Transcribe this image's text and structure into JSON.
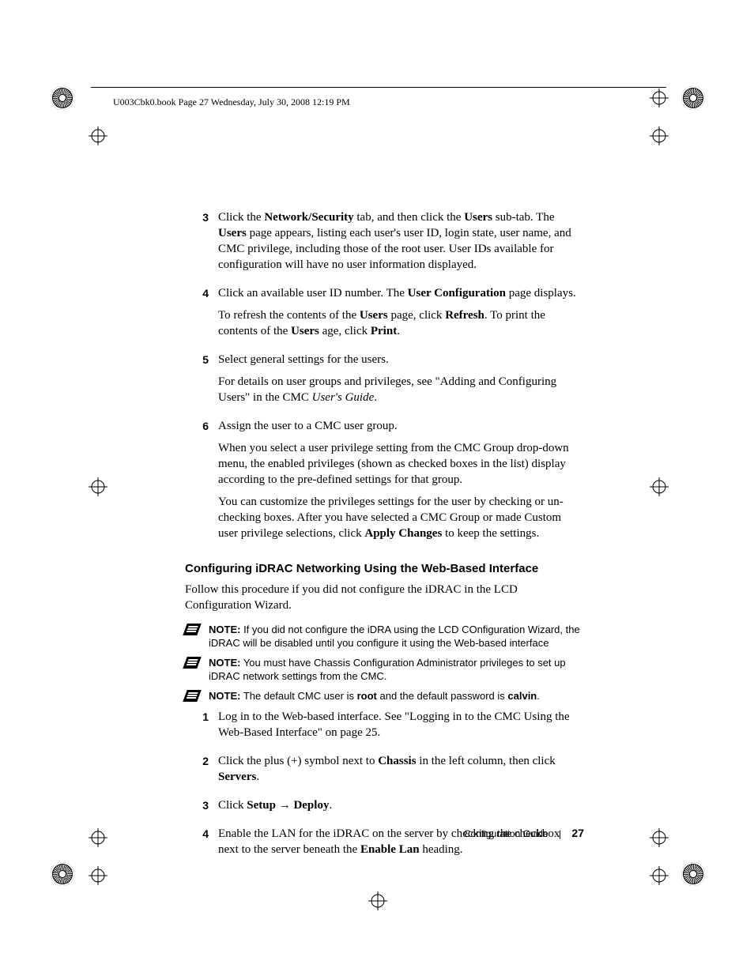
{
  "header": "U003Cbk0.book  Page 27  Wednesday, July 30, 2008  12:19 PM",
  "steps_a": [
    {
      "n": "3",
      "paras": [
        "Click the <b>Network/Security</b> tab, and then click the <b>Users</b> sub-tab. The <b>Users</b> page appears, listing each user's user ID, login state, user name, and CMC privilege, including those of the root user. User IDs available for configuration will have no user information displayed."
      ]
    },
    {
      "n": "4",
      "paras": [
        "Click an available user ID number. The <b>User Configuration</b> page displays.",
        "To refresh the contents of the <b>Users</b> page, click <b>Refresh</b>. To print the contents of the <b>Users</b> age, click <b>Print</b>."
      ]
    },
    {
      "n": "5",
      "paras": [
        "Select general settings for the users.",
        "For details on user groups and privileges, see \"Adding and Configuring Users\" in the CMC <i>User's Guide</i>."
      ]
    },
    {
      "n": "6",
      "paras": [
        "Assign the user to a CMC user group.",
        "When you select a user privilege setting from the CMC Group drop-down menu, the enabled privileges (shown as checked boxes in the list) display according to the pre-defined settings for that group.",
        "You can customize the privileges settings for the user by checking or un-checking boxes. After you have selected a CMC Group or made Custom user privilege selections, click <b>Apply Changes</b> to keep the settings."
      ]
    }
  ],
  "heading": "Configuring iDRAC Networking Using the Web-Based Interface",
  "intro": "Follow this procedure if you did not configure the iDRAC in the LCD Configuration Wizard.",
  "notes": [
    "<b>NOTE:</b> If you did not configure the iDRA using the LCD COnfiguration Wizard, the iDRAC will be disabled until you configure it using the Web-based interface",
    "<b>NOTE:</b> You must have Chassis Configuration Administrator privileges to set up iDRAC network settings from the CMC.",
    "<b>NOTE:</b> The default CMC user is <b>root</b> and the default password is <b>calvin</b>."
  ],
  "steps_b": [
    {
      "n": "1",
      "paras": [
        "Log in to the Web-based interface. See \"Logging in to the CMC Using the Web-Based Interface\" on page 25."
      ]
    },
    {
      "n": "2",
      "paras": [
        "Click the plus (+) symbol next to <b>Chassis</b> in the left column, then click <b>Servers</b>."
      ]
    },
    {
      "n": "3",
      "paras": [
        "Click <b>Setup</b> → <b>Deploy</b>."
      ]
    },
    {
      "n": "4",
      "paras": [
        "Enable the LAN for the iDRAC on the server by checking the checkbox next to the server beneath the <b>Enable Lan</b> heading."
      ]
    }
  ],
  "footer": {
    "title": "Configuration Guide",
    "page": "27"
  }
}
